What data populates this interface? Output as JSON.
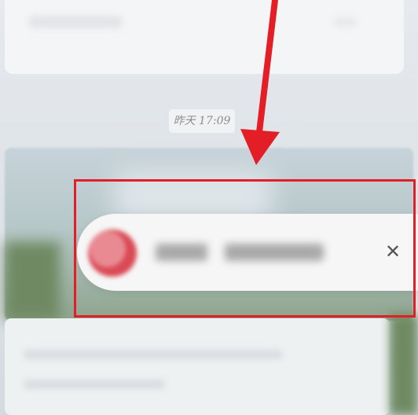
{
  "timestamp": {
    "text": "昨天 17:09"
  },
  "notification": {
    "close_symbol": "✕"
  },
  "colors": {
    "annotation_red": "#e41e26",
    "toast_background": "#f6f6f6",
    "avatar_red": "#d94a55"
  },
  "icons": {
    "close": "close-icon",
    "avatar": "avatar"
  }
}
